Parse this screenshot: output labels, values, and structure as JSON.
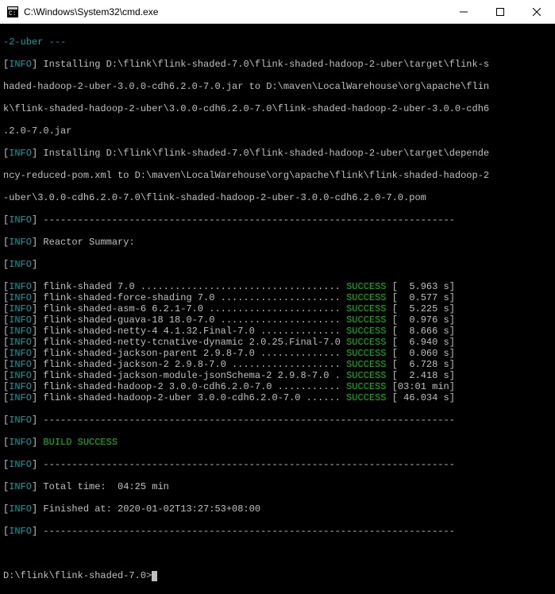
{
  "titlebar": {
    "title": "C:\\Windows\\System32\\cmd.exe"
  },
  "terminal": {
    "frag_line": "-2-uber ---",
    "install_lines": [
      "Installing D:\\flink\\flink-shaded-7.0\\flink-shaded-hadoop-2-uber\\target\\flink-s",
      "haded-hadoop-2-uber-3.0.0-cdh6.2.0-7.0.jar to D:\\maven\\LocalWarehouse\\org\\apache\\flin",
      "k\\flink-shaded-hadoop-2-uber\\3.0.0-cdh6.2.0-7.0\\flink-shaded-hadoop-2-uber-3.0.0-cdh6",
      ".2.0-7.0.jar"
    ],
    "install_lines2": [
      "Installing D:\\flink\\flink-shaded-7.0\\flink-shaded-hadoop-2-uber\\target\\depende",
      "ncy-reduced-pom.xml to D:\\maven\\LocalWarehouse\\org\\apache\\flink\\flink-shaded-hadoop-2",
      "-uber\\3.0.0-cdh6.2.0-7.0\\flink-shaded-hadoop-2-uber-3.0.0-cdh6.2.0-7.0.pom"
    ],
    "separator": "------------------------------------------------------------------------",
    "reactor_title": "Reactor Summary:",
    "info_tag": "INFO",
    "reactor": [
      {
        "name": "flink-shaded 7.0 ...................................",
        "status": "SUCCESS",
        "time": "[  5.963 s]"
      },
      {
        "name": "flink-shaded-force-shading 7.0 .....................",
        "status": "SUCCESS",
        "time": "[  0.577 s]"
      },
      {
        "name": "flink-shaded-asm-6 6.2.1-7.0 .......................",
        "status": "SUCCESS",
        "time": "[  5.225 s]"
      },
      {
        "name": "flink-shaded-guava-18 18.0-7.0 .....................",
        "status": "SUCCESS",
        "time": "[  0.976 s]"
      },
      {
        "name": "flink-shaded-netty-4 4.1.32.Final-7.0 ..............",
        "status": "SUCCESS",
        "time": "[  8.666 s]"
      },
      {
        "name": "flink-shaded-netty-tcnative-dynamic 2.0.25.Final-7.0",
        "status": "SUCCESS",
        "time": "[  6.940 s]"
      },
      {
        "name": "flink-shaded-jackson-parent 2.9.8-7.0 ..............",
        "status": "SUCCESS",
        "time": "[  0.060 s]"
      },
      {
        "name": "flink-shaded-jackson-2 2.9.8-7.0 ...................",
        "status": "SUCCESS",
        "time": "[  6.728 s]"
      },
      {
        "name": "flink-shaded-jackson-module-jsonSchema-2 2.9.8-7.0 .",
        "status": "SUCCESS",
        "time": "[  2.418 s]"
      },
      {
        "name": "flink-shaded-hadoop-2 3.0.0-cdh6.2.0-7.0 ...........",
        "status": "SUCCESS",
        "time": "[03:01 min]"
      },
      {
        "name": "flink-shaded-hadoop-2-uber 3.0.0-cdh6.2.0-7.0 ......",
        "status": "SUCCESS",
        "time": "[ 46.034 s]"
      }
    ],
    "build_success": "BUILD SUCCESS",
    "total_time": "Total time:  04:25 min",
    "finished_at": "Finished at: 2020-01-02T13:27:53+08:00",
    "prompt": "D:\\flink\\flink-shaded-7.0>"
  }
}
